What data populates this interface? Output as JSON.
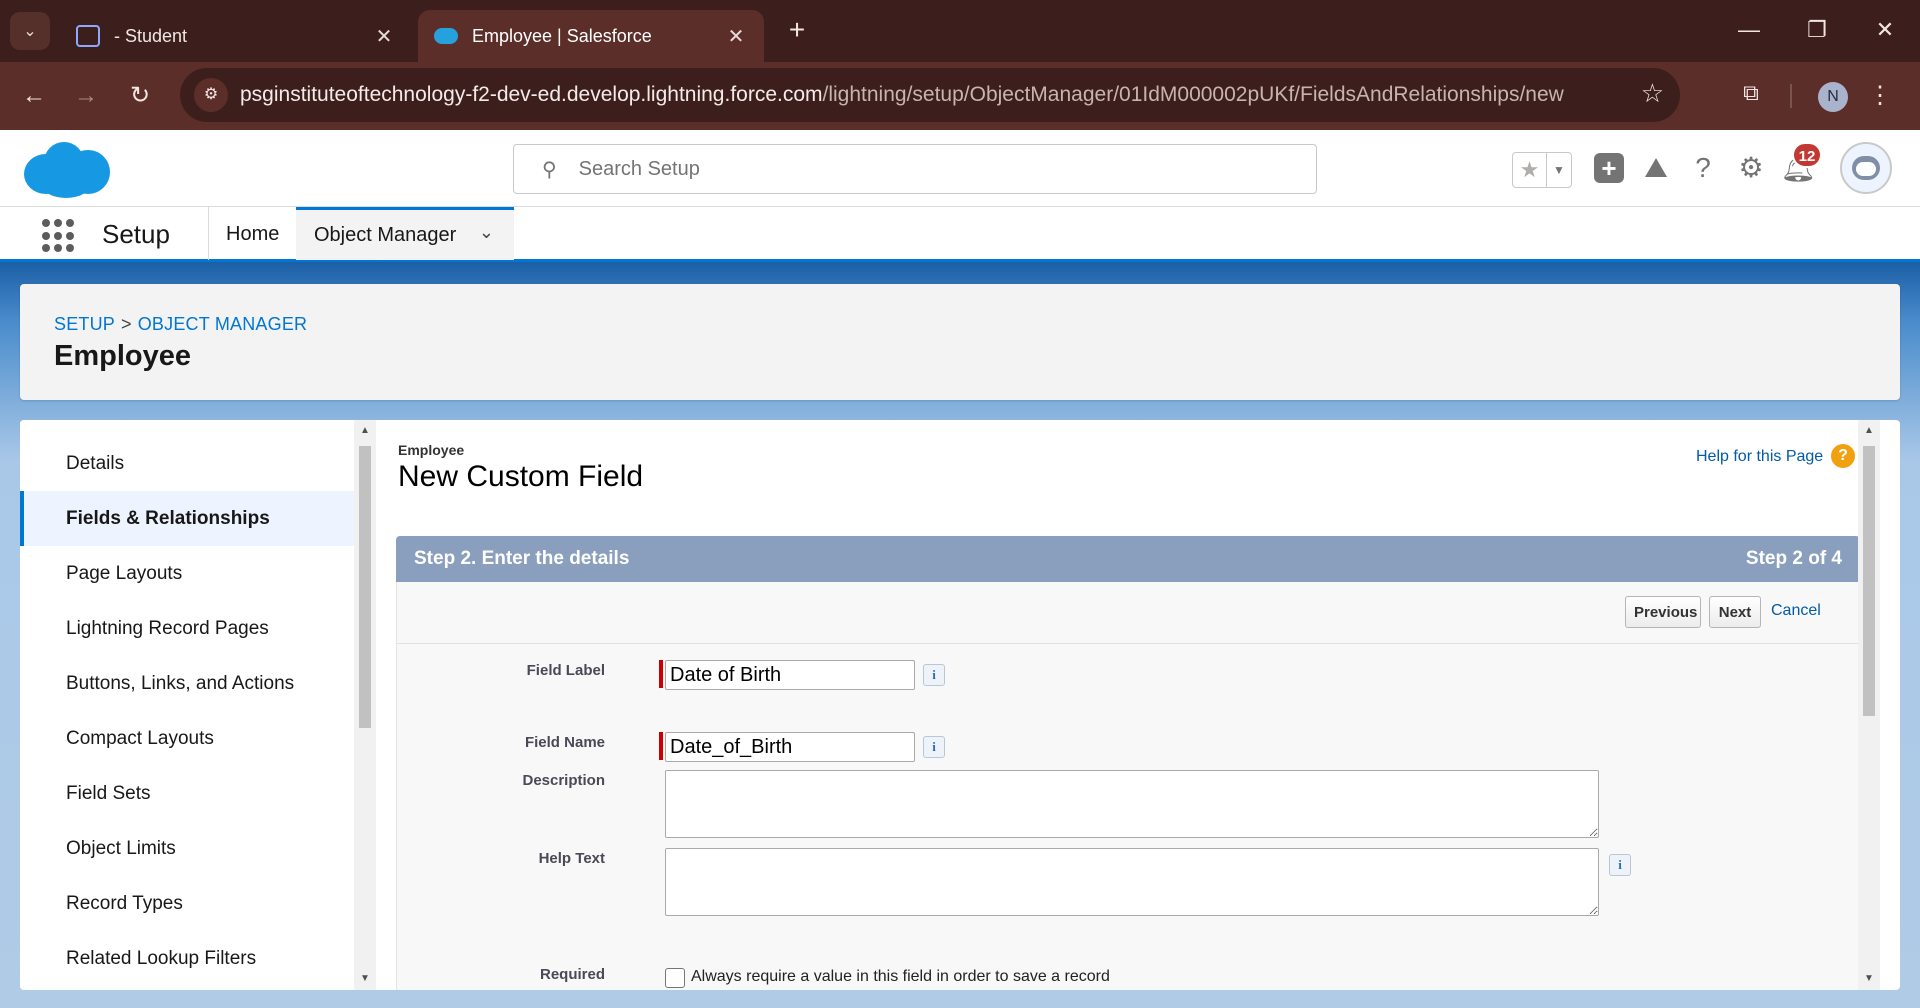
{
  "browser": {
    "tabs": [
      {
        "title": "- Student",
        "close": "✕"
      },
      {
        "title": "Employee | Salesforce",
        "close": "✕"
      }
    ],
    "new_tab": "+",
    "url_host": "psginstituteoftechnology-f2-dev-ed.develop.lightning.force.com",
    "url_path": "/lightning/setup/ObjectManager/01IdM000002pUKf/FieldsAndRelationships/new",
    "profile_initial": "N"
  },
  "header": {
    "search_placeholder": "Search Setup",
    "notification_count": "12"
  },
  "appnav": {
    "app_name": "Setup",
    "home": "Home",
    "object_manager": "Object Manager"
  },
  "page": {
    "breadcrumb": [
      "SETUP",
      "OBJECT MANAGER"
    ],
    "breadcrumb_sep": ">",
    "title": "Employee"
  },
  "sidebar": {
    "items": [
      {
        "label": "Details"
      },
      {
        "label": "Fields & Relationships",
        "active": true
      },
      {
        "label": "Page Layouts"
      },
      {
        "label": "Lightning Record Pages"
      },
      {
        "label": "Buttons, Links, and Actions"
      },
      {
        "label": "Compact Layouts"
      },
      {
        "label": "Field Sets"
      },
      {
        "label": "Object Limits"
      },
      {
        "label": "Record Types"
      },
      {
        "label": "Related Lookup Filters"
      }
    ]
  },
  "form": {
    "object_name": "Employee",
    "title": "New Custom Field",
    "help_link": "Help for this Page",
    "step_title": "Step 2. Enter the details",
    "step_count": "Step 2 of 4",
    "buttons": {
      "previous": "Previous",
      "next": "Next",
      "cancel": "Cancel"
    },
    "fields": {
      "field_label": {
        "label": "Field Label",
        "value": "Date of Birth"
      },
      "field_name": {
        "label": "Field Name",
        "value": "Date_of_Birth"
      },
      "description": {
        "label": "Description",
        "value": ""
      },
      "help_text": {
        "label": "Help Text",
        "value": ""
      },
      "required": {
        "label": "Required",
        "checkbox_text": "Always require a value in this field in order to save a record",
        "checked": false
      }
    }
  },
  "colors": {
    "brand_blue": "#0176d3",
    "step_bar": "#8a9ebe",
    "required_red": "#cc0000"
  }
}
